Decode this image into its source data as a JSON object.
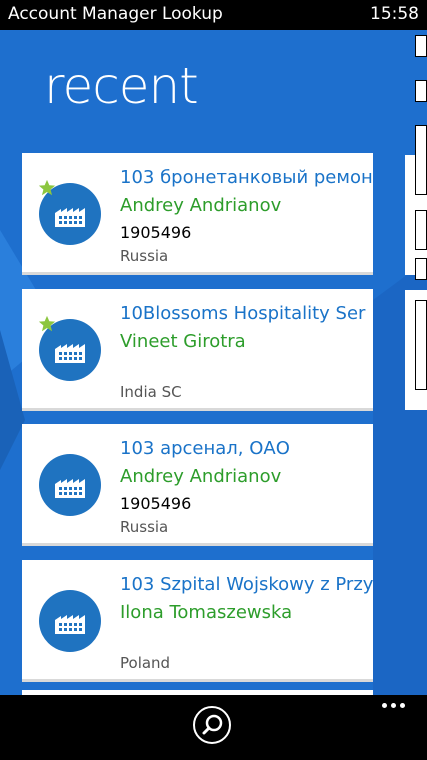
{
  "statusbar": {
    "app_title": "Account Manager Lookup",
    "time": "15:58"
  },
  "page": {
    "title": "recent"
  },
  "accounts": [
    {
      "name": "103 бронетанковый ремон",
      "contact": "Andrey Andrianov",
      "number": "1905496",
      "country": "Russia",
      "favorite": true
    },
    {
      "name": " 10Blossoms Hospitality Ser",
      "contact": "Vineet Girotra",
      "number": "",
      "country": "India SC",
      "favorite": true
    },
    {
      "name": " 103 арсенал, ОАО",
      "contact": "Andrey Andrianov",
      "number": "1905496",
      "country": "Russia",
      "favorite": false
    },
    {
      "name": "103 Szpital Wojskowy z Przy",
      "contact": "Ilona Tomaszewska",
      "number": "",
      "country": "Poland",
      "favorite": false
    }
  ],
  "icons": {
    "account": "factory-icon",
    "favorite": "star-icon",
    "search": "search-icon",
    "more": "more-icon"
  },
  "colors": {
    "background": "#1e6fce",
    "account_name": "#1a73c8",
    "contact_name": "#2d9d2b",
    "avatar": "#1f73c0",
    "star": "#8cc63f"
  }
}
